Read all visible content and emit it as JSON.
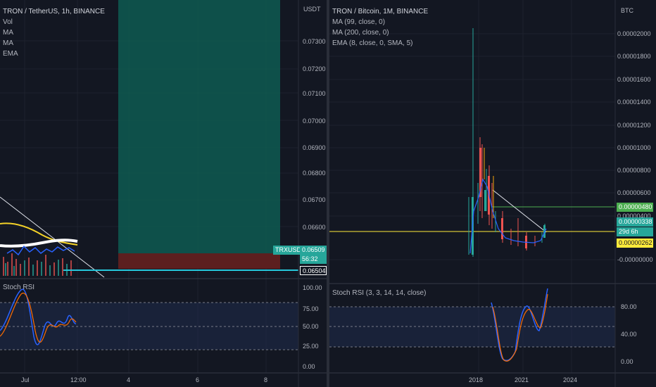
{
  "left_chart": {
    "legend": {
      "title": "TRON / TetherUS, 1h, BINANCE",
      "lines": [
        "Vol",
        "MA",
        "MA",
        "EMA"
      ]
    },
    "currency": "USDT",
    "price_ticks": [
      "0.07300",
      "0.07200",
      "0.07100",
      "0.07000",
      "0.06900",
      "0.06800",
      "0.06700",
      "0.06600"
    ],
    "symbol_tag": "TRXUSDT",
    "last_price": "0.06509",
    "countdown": "56:32",
    "line_price": "0.06504",
    "rsi_title": "Stoch RSI",
    "rsi_ticks": [
      "100.00",
      "75.00",
      "50.00",
      "25.00",
      "0.00"
    ],
    "time_ticks": [
      "Jul",
      "12:00",
      "4",
      "6",
      "8"
    ],
    "colors": {
      "long_zone": "#0e5b51",
      "stop_zone": "#5c1f1f",
      "tag": "#26a69a"
    }
  },
  "right_chart": {
    "legend": {
      "title": "TRON / Bitcoin, 1M, BINANCE",
      "lines": [
        "MA (99, close, 0)",
        "MA (200, close, 0)",
        "EMA (8, close, 0, SMA, 5)"
      ]
    },
    "currency": "BTC",
    "price_ticks": [
      "0.00002000",
      "0.00001800",
      "0.00001600",
      "0.00001400",
      "0.00001200",
      "0.00001000",
      "0.00000800",
      "0.00000600",
      "0.00000400",
      "-0.00000000"
    ],
    "green_tag": "0.00000480",
    "last_price": "0.00000338",
    "countdown": "29d 6h",
    "yellow_tag": "0.00000262",
    "rsi_title": "Stoch RSI (3, 3, 14, 14, close)",
    "rsi_ticks": [
      "80.00",
      "40.00",
      "0.00"
    ],
    "time_ticks": [
      "2018",
      "2021",
      "2024"
    ],
    "colors": {
      "green_line": "#4caf50",
      "yellow_line": "#ffeb3b",
      "tag": "#26a69a"
    }
  }
}
